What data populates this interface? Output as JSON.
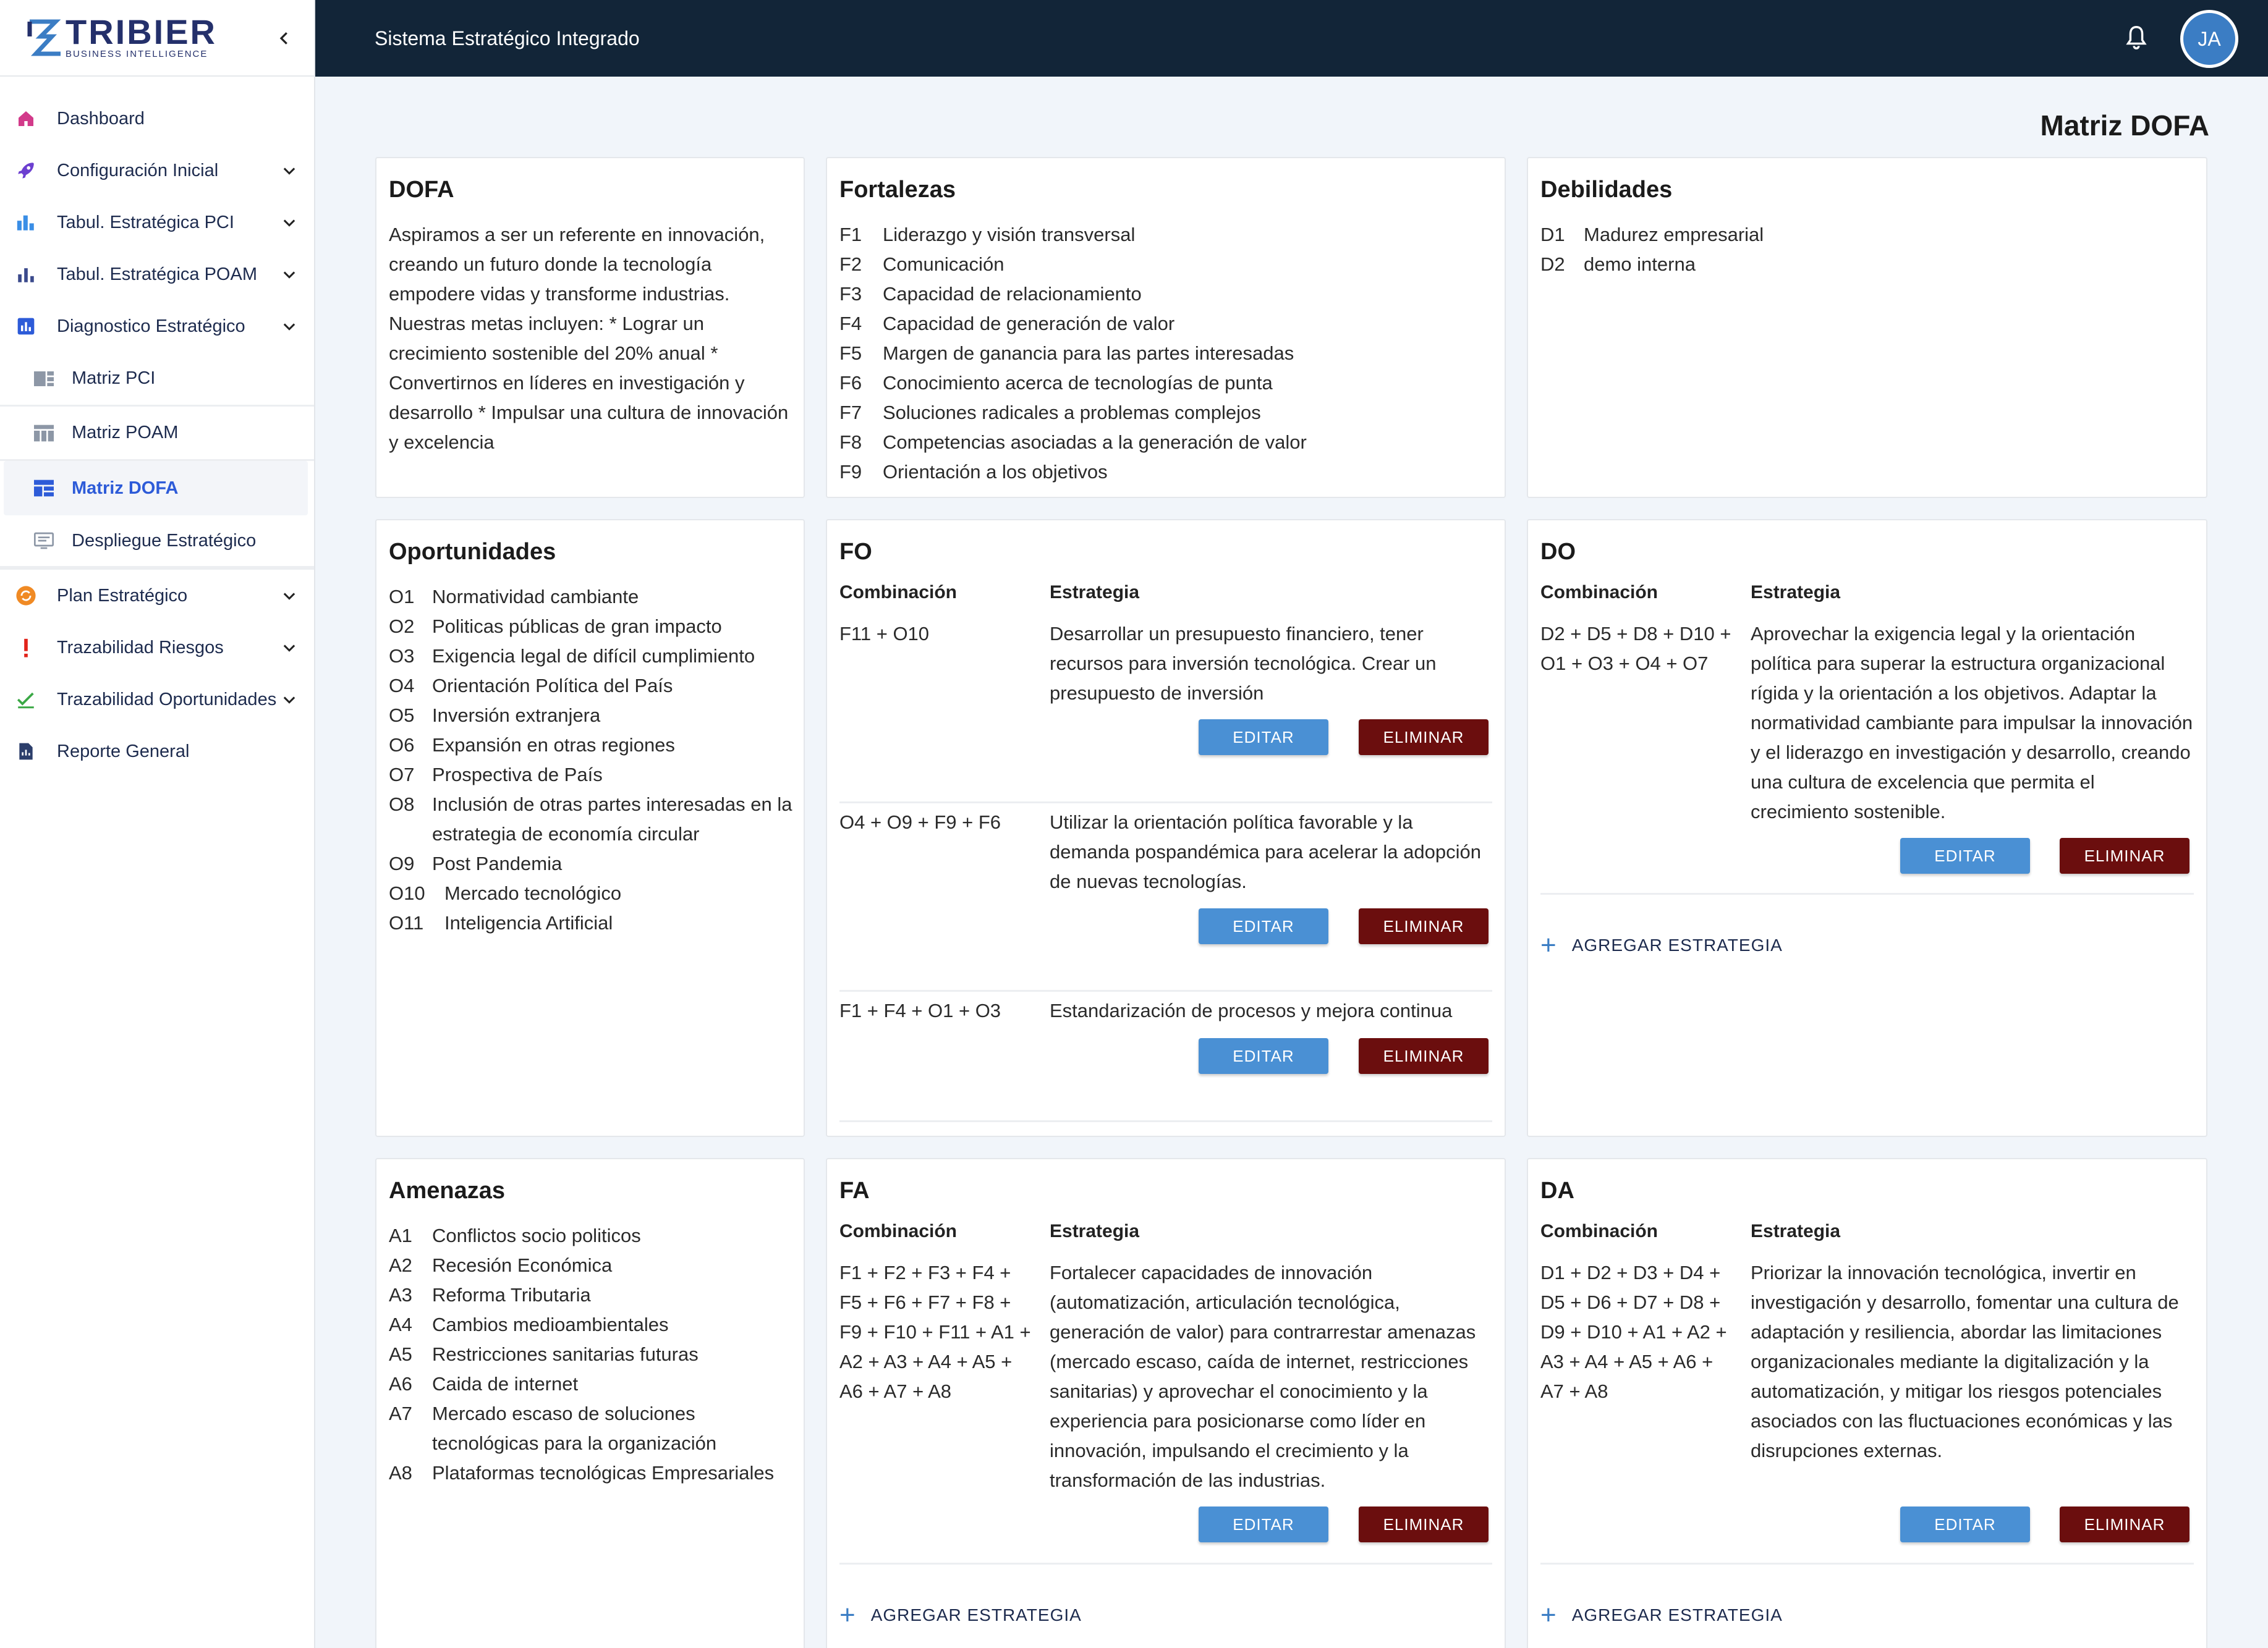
{
  "brand": {
    "name": "TRIBIER",
    "sub": "BUSINESS INTELLIGENCE"
  },
  "header": {
    "title": "Sistema Estratégico Integrado",
    "avatar": "JA"
  },
  "sidebar": {
    "items": [
      {
        "label": "Dashboard"
      },
      {
        "label": "Configuración Inicial"
      },
      {
        "label": "Tabul. Estratégica PCI"
      },
      {
        "label": "Tabul. Estratégica POAM"
      },
      {
        "label": "Diagnostico Estratégico"
      }
    ],
    "subitems": [
      {
        "label": "Matriz PCI"
      },
      {
        "label": "Matriz POAM"
      },
      {
        "label": "Matriz DOFA"
      },
      {
        "label": "Despliegue Estratégico"
      }
    ],
    "items2": [
      {
        "label": "Plan Estratégico"
      },
      {
        "label": "Trazabilidad Riesgos"
      },
      {
        "label": "Trazabilidad Oportunidades"
      },
      {
        "label": "Reporte General"
      }
    ]
  },
  "page": {
    "title": "Matriz DOFA"
  },
  "labels": {
    "combinacion": "Combinación",
    "estrategia": "Estrategia",
    "editar": "EDITAR",
    "eliminar": "ELIMINAR",
    "agregar": "AGREGAR ESTRATEGIA"
  },
  "dofa": {
    "title": "DOFA",
    "text": "Aspiramos a ser un referente en innovación, creando un futuro donde la tecnología empodere vidas y transforme industrias. Nuestras metas incluyen: * Lograr un crecimiento sostenible del 20% anual * Convertirnos en líderes en investigación y desarrollo * Impulsar una cultura de innovación y excelencia"
  },
  "fortalezas": {
    "title": "Fortalezas",
    "items": [
      {
        "code": "F1",
        "text": "Liderazgo y visión transversal"
      },
      {
        "code": "F2",
        "text": "Comunicación"
      },
      {
        "code": "F3",
        "text": "Capacidad de relacionamiento"
      },
      {
        "code": "F4",
        "text": "Capacidad de generación de valor"
      },
      {
        "code": "F5",
        "text": "Margen de ganancia para las partes interesadas"
      },
      {
        "code": "F6",
        "text": "Conocimiento acerca de tecnologías de punta"
      },
      {
        "code": "F7",
        "text": "Soluciones radicales a problemas complejos"
      },
      {
        "code": "F8",
        "text": "Competencias asociadas a la generación de valor"
      },
      {
        "code": "F9",
        "text": "Orientación a los objetivos"
      }
    ]
  },
  "debilidades": {
    "title": "Debilidades",
    "items": [
      {
        "code": "D1",
        "text": "Madurez empresarial"
      },
      {
        "code": "D2",
        "text": "demo interna"
      }
    ]
  },
  "oportunidades": {
    "title": "Oportunidades",
    "items": [
      {
        "code": "O1",
        "text": "Normatividad cambiante"
      },
      {
        "code": "O2",
        "text": "Politicas públicas de gran impacto"
      },
      {
        "code": "O3",
        "text": "Exigencia legal de difícil cumplimiento"
      },
      {
        "code": "O4",
        "text": "Orientación Política del País"
      },
      {
        "code": "O5",
        "text": "Inversión extranjera"
      },
      {
        "code": "O6",
        "text": "Expansión en otras regiones"
      },
      {
        "code": "O7",
        "text": "Prospectiva de País"
      },
      {
        "code": "O8",
        "text": "Inclusión de otras partes interesadas en la estrategia de economía circular"
      },
      {
        "code": "O9",
        "text": "Post Pandemia"
      },
      {
        "code": "O10",
        "text": "Mercado tecnológico"
      },
      {
        "code": "O11",
        "text": "Inteligencia Artificial"
      }
    ]
  },
  "fo": {
    "title": "FO",
    "rows": [
      {
        "combo": "F11 + O10",
        "strategy": "Desarrollar un presupuesto financiero, tener recursos para inversión tecnológica. Crear un presupuesto de inversión"
      },
      {
        "combo": "O4 + O9 + F9 + F6",
        "strategy": "Utilizar la orientación política favorable y la demanda pospandémica para acelerar la adopción de nuevas tecnologías."
      },
      {
        "combo": "F1 + F4 + O1 + O3",
        "strategy": "Estandarización de procesos y mejora continua"
      }
    ]
  },
  "do": {
    "title": "DO",
    "rows": [
      {
        "combo": "D2 + D5 + D8 + D10 + O1 + O3 + O4 + O7",
        "strategy": "Aprovechar la exigencia legal y la orientación política para superar la estructura organizacional rígida y la orientación a los objetivos. Adaptar la normatividad cambiante para impulsar la innovación y el liderazgo en investigación y desarrollo, creando una cultura de excelencia que permita el crecimiento sostenible."
      }
    ]
  },
  "amenazas": {
    "title": "Amenazas",
    "items": [
      {
        "code": "A1",
        "text": "Conflictos socio politicos"
      },
      {
        "code": "A2",
        "text": "Recesión Económica"
      },
      {
        "code": "A3",
        "text": "Reforma Tributaria"
      },
      {
        "code": "A4",
        "text": "Cambios medioambientales"
      },
      {
        "code": "A5",
        "text": "Restricciones sanitarias futuras"
      },
      {
        "code": "A6",
        "text": "Caida de internet"
      },
      {
        "code": "A7",
        "text": "Mercado escaso de soluciones tecnológicas para la organización"
      },
      {
        "code": "A8",
        "text": "Plataformas tecnológicas Empresariales"
      }
    ]
  },
  "fa": {
    "title": "FA",
    "rows": [
      {
        "combo": "F1 + F2 + F3 + F4 + F5 + F6 + F7 + F8 + F9 + F10 + F11 + A1 + A2 + A3 + A4 + A5 + A6 + A7 + A8",
        "strategy": "Fortalecer capacidades de innovación (automatización, articulación tecnológica, generación de valor) para contrarrestar amenazas (mercado escaso, caída de internet, restricciones sanitarias) y aprovechar el conocimiento y la experiencia para posicionarse como líder en innovación, impulsando el crecimiento y la transformación de las industrias."
      }
    ]
  },
  "da": {
    "title": "DA",
    "rows": [
      {
        "combo": "D1 + D2 + D3 + D4 + D5 + D6 + D7 + D8 + D9 + D10 + A1 + A2 + A3 + A4 + A5 + A6 + A7 + A8",
        "strategy": "Priorizar la innovación tecnológica, invertir en investigación y desarrollo, fomentar una cultura de adaptación y resiliencia, abordar las limitaciones organizacionales mediante la digitalización y la automatización, y mitigar los riesgos potenciales asociados con las fluctuaciones económicas y las disrupciones externas."
      }
    ]
  }
}
